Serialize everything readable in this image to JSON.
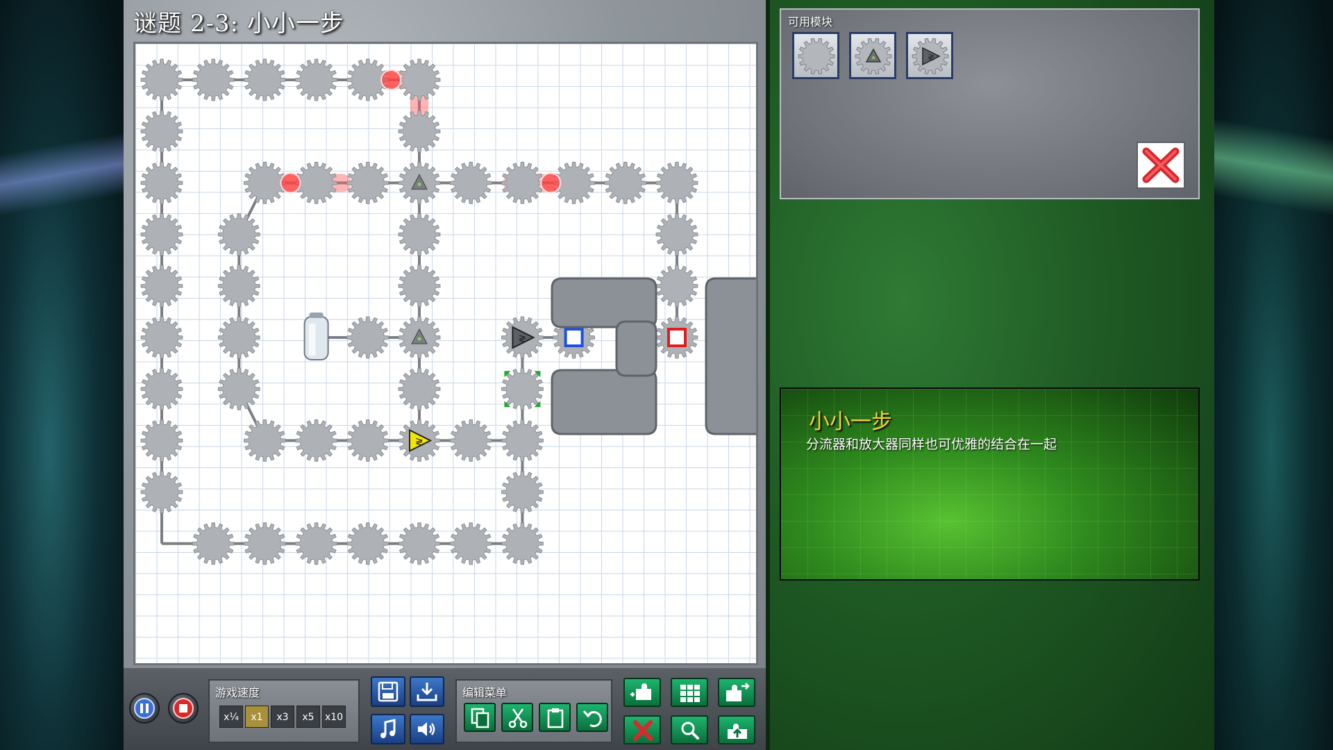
{
  "title": "谜题 2-3: 小小一步",
  "modules_panel": {
    "label": "可用模块",
    "items": [
      "gear-module",
      "splitter-module",
      "amplifier-module"
    ]
  },
  "info": {
    "title": "小小一步",
    "text": "分流器和放大器同样也可优雅的结合在一起"
  },
  "toolbar": {
    "pause_icon": "pause-icon",
    "stop_icon": "stop-icon",
    "speed_label": "游戏速度",
    "speeds": [
      "x¼",
      "x1",
      "x3",
      "x5",
      "x10"
    ],
    "active_speed": "x1",
    "edit_label": "编辑菜单"
  },
  "colors": {
    "gear": "#a9adb2",
    "laser": "#ff6b6b",
    "receiver_blue": "#1d4fe0",
    "receiver_red": "#e01d1d",
    "amplifier_yellow": "#f2e600"
  }
}
